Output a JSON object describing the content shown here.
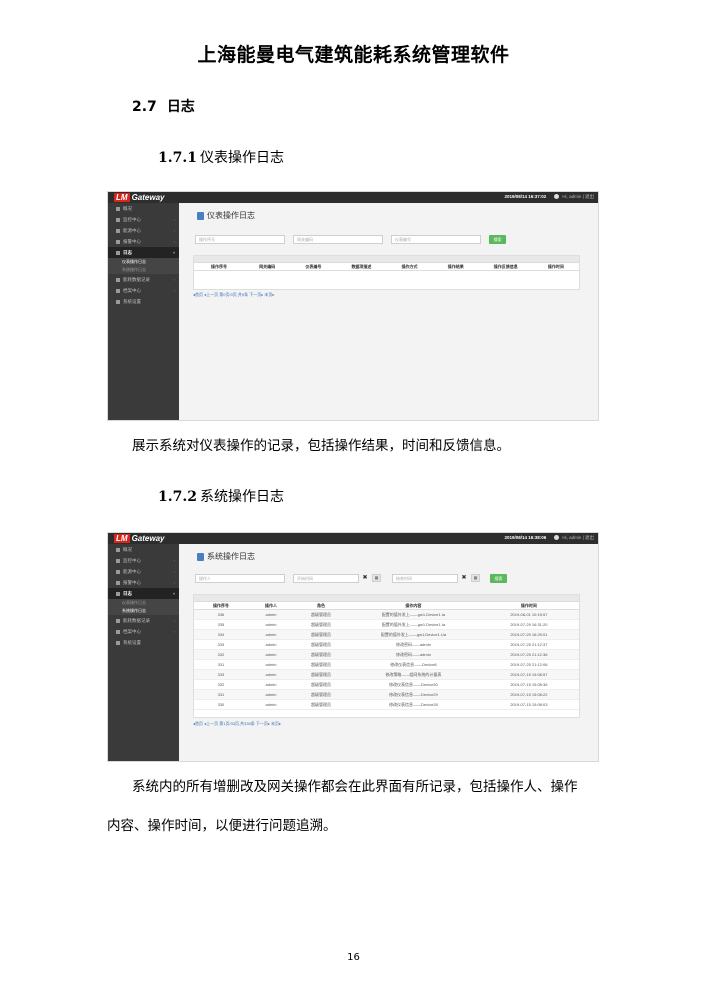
{
  "doc": {
    "title": "上海能曼电气建筑能耗系统管理软件",
    "section_num": "2.7",
    "section_title": "日志",
    "sub1_num": "1.7.1",
    "sub1_title": "仪表操作日志",
    "para1": "展示系统对仪表操作的记录，包括操作结果，时间和反馈信息。",
    "sub2_num": "1.7.2",
    "sub2_title": "系统操作日志",
    "para2_line1": "系统内的所有增删改及网关操作都会在此界面有所记录，包括操作人、操作",
    "para2_line2": "内容、操作时间，以便进行问题追溯。",
    "page_number": "16"
  },
  "shot1": {
    "logo_badge": "LM",
    "logo_text": "Gateway",
    "time": "2019/08/14  16:37:02",
    "user": "Hi, admin | 退出",
    "nav": [
      {
        "label": "概况"
      },
      {
        "label": "监控中心"
      },
      {
        "label": "能源中心"
      },
      {
        "label": "报警中心"
      },
      {
        "label": "日志"
      },
      {
        "label": "仪表操作日志"
      },
      {
        "label": "系统操作日志"
      },
      {
        "label": "能耗数据记录"
      },
      {
        "label": "档案中心"
      },
      {
        "label": "系统设置"
      }
    ],
    "page_title": "仪表操作日志",
    "placeholders": [
      "操作序号",
      "网关编码",
      "仪表编号"
    ],
    "search_label": "搜索",
    "columns": [
      "操作序号",
      "网关编码",
      "仪表编号",
      "数据项描述",
      "操作方式",
      "操作结果",
      "操作反馈信息",
      "操作时间"
    ],
    "pager": "◂首页  ◂上一页  第0页/0页,共0条  下一页▸  末页▸"
  },
  "shot2": {
    "logo_badge": "LM",
    "logo_text": "Gateway",
    "time": "2019/08/14  16:38:06",
    "user": "Hi, admin | 退出",
    "nav": [
      {
        "label": "概况"
      },
      {
        "label": "监控中心"
      },
      {
        "label": "能源中心"
      },
      {
        "label": "报警中心"
      },
      {
        "label": "日志"
      },
      {
        "label": "仪表操作日志"
      },
      {
        "label": "系统操作日志"
      },
      {
        "label": "能耗数据记录"
      },
      {
        "label": "档案中心"
      },
      {
        "label": "系统设置"
      }
    ],
    "page_title": "系统操作日志",
    "placeholders": [
      "操作人",
      "开始时间",
      "结束时间"
    ],
    "clear_icon": "✖",
    "calendar_icon": "▦",
    "search_label": "搜索",
    "columns": [
      "操作序号",
      "操作人",
      "角色",
      "操作内容",
      "操作时间"
    ],
    "rows": [
      [
        "336",
        "admin",
        "超级管理员",
        "配置的值外发上——gw1.Device1.Ia",
        "2019-08-01 10:15:57"
      ],
      [
        "335",
        "admin",
        "超级管理员",
        "配置的值外发上——gw1.Device1.Ia",
        "2019-07-29 16:31:20"
      ],
      [
        "334",
        "admin",
        "超级管理员",
        "配置的值外发上——gw1.Device1.Ua",
        "2019-07-29 16:25:01"
      ],
      [
        "333",
        "admin",
        "超级管理员",
        "修改密码——admin",
        "2019-07-25 21:12:37"
      ],
      [
        "332",
        "admin",
        "超级管理员",
        "修改密码——admin",
        "2019-07-25 21:12:36"
      ],
      [
        "331",
        "admin",
        "超级管理员",
        "修改仪表信息——Device8",
        "2019-07-25 21:12:06"
      ],
      [
        "333",
        "admin",
        "超级管理员",
        "修改策略——组网系统的计量表",
        "2019-07-15 15:08:57"
      ],
      [
        "332",
        "admin",
        "超级管理员",
        "修改仪表信息——Device30",
        "2019-07-15 15:08:36"
      ],
      [
        "331",
        "admin",
        "超级管理员",
        "修改仪表信息——Device29",
        "2019-07-15 15:08:22"
      ],
      [
        "330",
        "admin",
        "超级管理员",
        "修改仪表信息——Device28",
        "2019-07-15 15:08:03"
      ]
    ],
    "pager": "◂首页  ◂上一页  第1页/33页,共330条  下一页▸  末页▸"
  }
}
